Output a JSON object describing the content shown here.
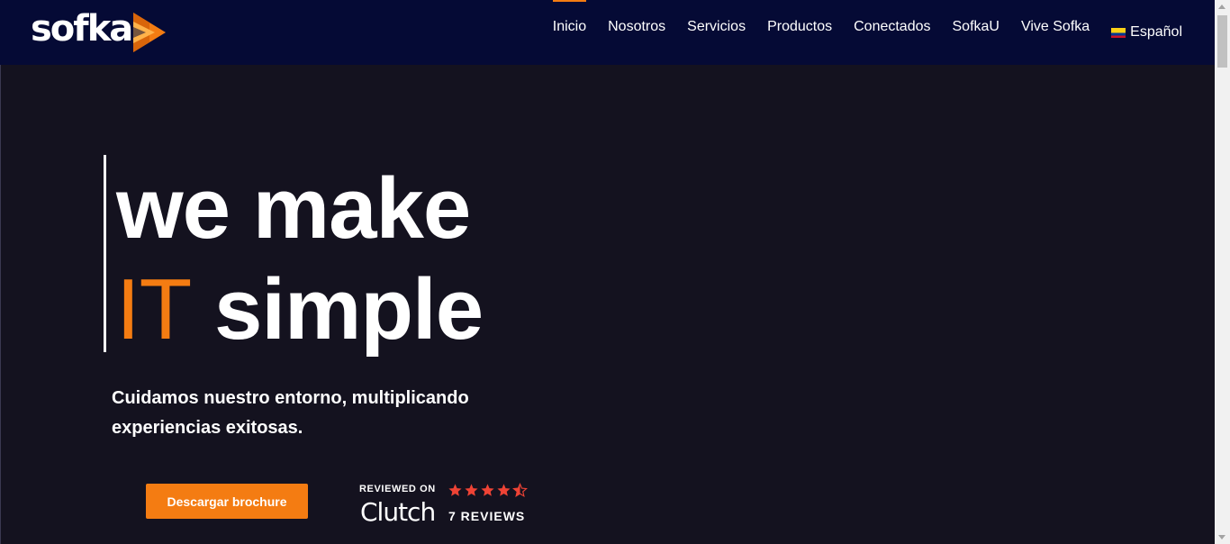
{
  "brand": {
    "logo_text": "sofka",
    "logo_icon": "sofka-arrow-logo-icon",
    "accent_color": "#f47c12",
    "header_bg": "#050a35",
    "hero_bg": "#14121f"
  },
  "nav": {
    "items": [
      {
        "label": "Inicio",
        "active": true
      },
      {
        "label": "Nosotros"
      },
      {
        "label": "Servicios"
      },
      {
        "label": "Productos"
      },
      {
        "label": "Conectados"
      },
      {
        "label": "SofkaU"
      },
      {
        "label": "Vive Sofka"
      }
    ],
    "language": {
      "label": "Español",
      "icon": "colombia-flag-icon"
    }
  },
  "hero": {
    "headline_line1": "we make",
    "headline_it": "IT",
    "headline_simple": "simple",
    "subtitle_line1": "Cuidamos nuestro entorno, multiplicando",
    "subtitle_line2": "experiencias exitosas.",
    "cta_label": "Descargar brochure"
  },
  "clutch": {
    "reviewed_on": "REVIEWED ON",
    "brand": "Clutch",
    "rating": 4.5,
    "rating_max": 5,
    "star_color": "#ef4335",
    "reviews_label": "7 REVIEWS"
  }
}
